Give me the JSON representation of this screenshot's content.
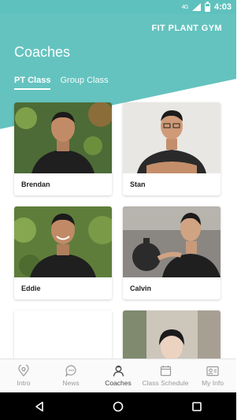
{
  "status": {
    "network": "4G",
    "time": "4:03"
  },
  "header": {
    "brand": "FIT PLANT GYM",
    "title": "Coaches"
  },
  "tabs": [
    {
      "label": "PT Class",
      "active": true
    },
    {
      "label": "Group Class",
      "active": false
    }
  ],
  "coaches": [
    {
      "name": "Brendan",
      "bg": "#5a7a3e"
    },
    {
      "name": "Stan",
      "bg": "#e8e6e2"
    },
    {
      "name": "Eddie",
      "bg": "#6f8f47"
    },
    {
      "name": "Calvin",
      "bg": "#6f6a66"
    },
    {
      "name": "",
      "bg": "#ffffff"
    },
    {
      "name": "",
      "bg": "#c9c3b9"
    }
  ],
  "bottom_nav": [
    {
      "label": "Intro",
      "icon": "map-pin-icon",
      "active": false
    },
    {
      "label": "News",
      "icon": "chat-bubble-icon",
      "active": false
    },
    {
      "label": "Coaches",
      "icon": "coach-person-icon",
      "active": true
    },
    {
      "label": "Class Schedule",
      "icon": "calendar-icon",
      "active": false
    },
    {
      "label": "My Info",
      "icon": "id-card-icon",
      "active": false
    }
  ],
  "colors": {
    "accent": "#64c3bf",
    "nav_active": "#444444",
    "nav_inactive": "#9a9a9a"
  }
}
